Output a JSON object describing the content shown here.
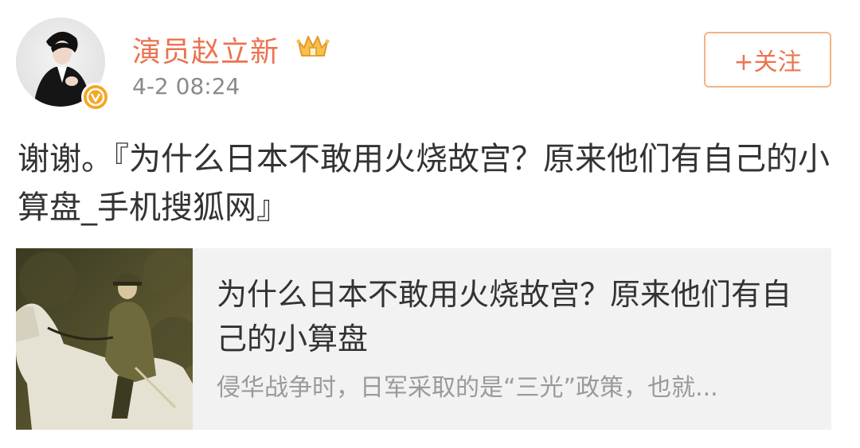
{
  "user": {
    "name": "演员赵立新",
    "timestamp": "4-2 08:24",
    "badge_color": "#f5a623",
    "name_color": "#eb7350",
    "crown_icon": "crown-icon",
    "verified_icon": "verified-v-icon"
  },
  "follow_button": {
    "label": "+关注"
  },
  "post": {
    "text": "谢谢。『为什么日本不敢用火烧故宫？原来他们有自己的小算盘_手机搜狐网』"
  },
  "link_card": {
    "title": "为什么日本不敢用火烧故宫？原来他们有自己的小算盘",
    "summary": "侵华战争时，日军采取的是“三光”政策，也就..."
  }
}
